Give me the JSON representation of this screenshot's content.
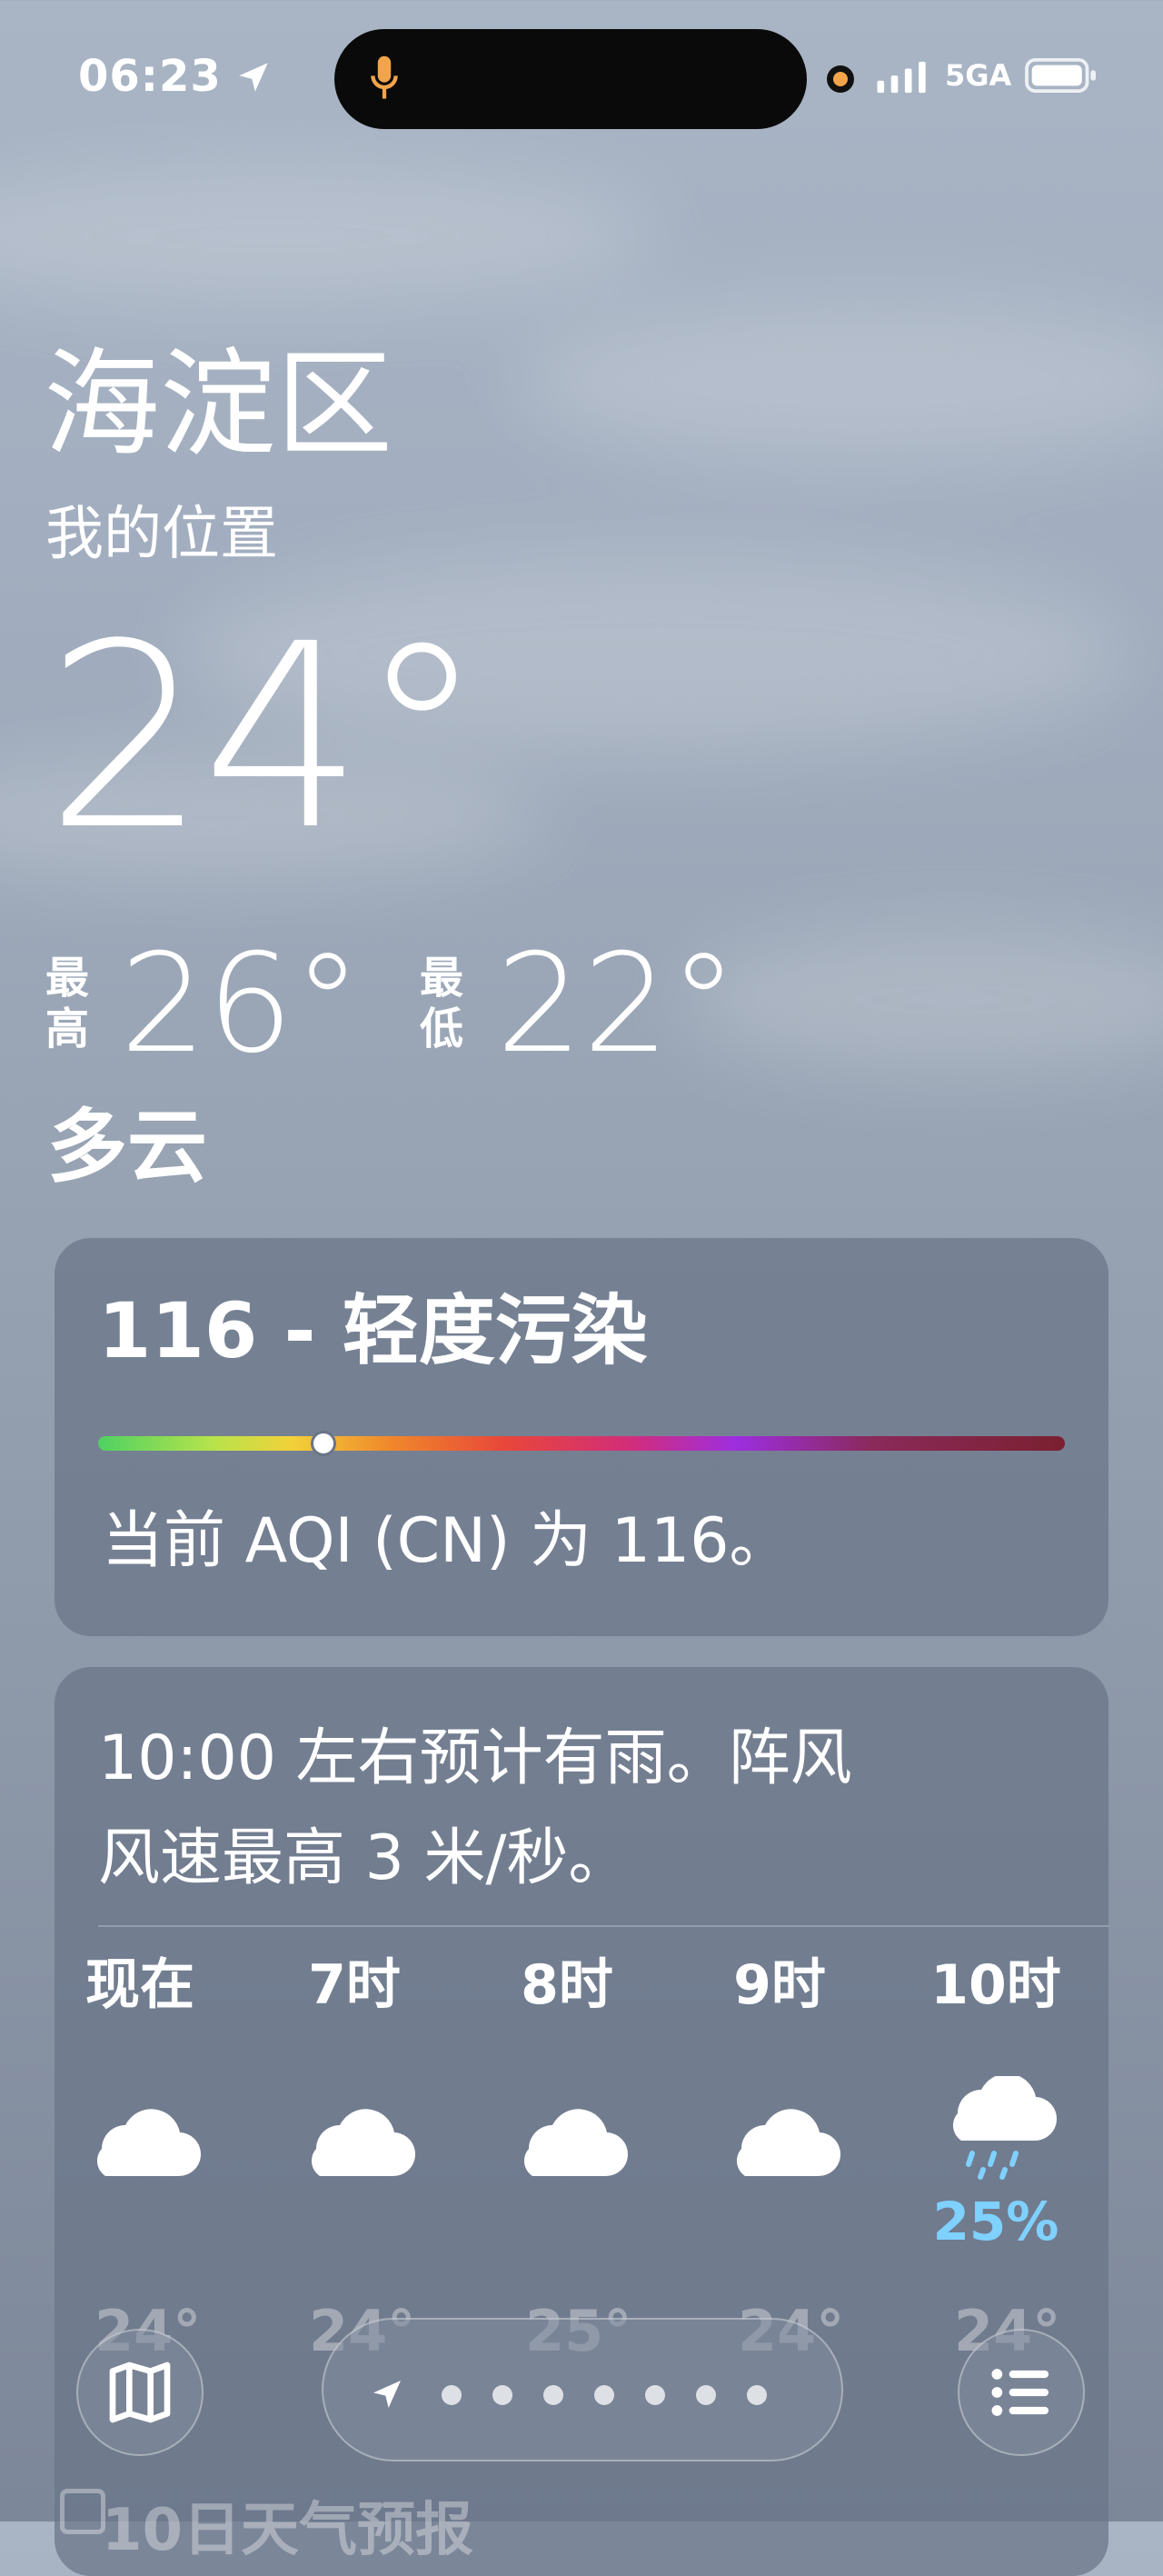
{
  "status_bar": {
    "time": "06:23",
    "network": "5GA",
    "icons": [
      "location-arrow-icon",
      "microphone-icon",
      "camera-indicator-icon",
      "signal-icon",
      "battery-icon"
    ]
  },
  "location": {
    "city": "海淀区",
    "subtitle": "我的位置"
  },
  "current": {
    "temperature": "24°",
    "high_label": "最高",
    "high_value": "26°",
    "low_label": "最低",
    "low_value": "22°",
    "condition": "多云"
  },
  "aqi": {
    "title": "116 - 轻度污染",
    "description": "当前 AQI (CN) 为 116。",
    "level_fraction": 0.23,
    "colors": {
      "good": "#4fd162",
      "moderate": "#f2d13a",
      "unhealthy": "#e8473a",
      "very_unhealthy": "#9d2ee0",
      "hazardous": "#7a2030"
    }
  },
  "hourly": {
    "summary_line1": "10:00 左右预计有雨。阵风",
    "summary_line2": "风速最高 3 米/秒。",
    "hours": [
      {
        "label": "现在",
        "icon": "cloud-icon",
        "temp": "24°"
      },
      {
        "label": "7时",
        "icon": "cloud-icon",
        "temp": "24°"
      },
      {
        "label": "8时",
        "icon": "cloud-icon",
        "temp": "25°"
      },
      {
        "label": "9时",
        "icon": "cloud-icon",
        "temp": "24°"
      },
      {
        "label": "10时",
        "icon": "cloud-rain-icon",
        "pop": "25%",
        "temp": "24°"
      }
    ]
  },
  "forecast": {
    "header": "10日天气预报"
  },
  "bottom_bar": {
    "page_count": 8,
    "current_page": 1,
    "icons": [
      "map-icon",
      "location-arrow-icon",
      "list-icon"
    ]
  }
}
